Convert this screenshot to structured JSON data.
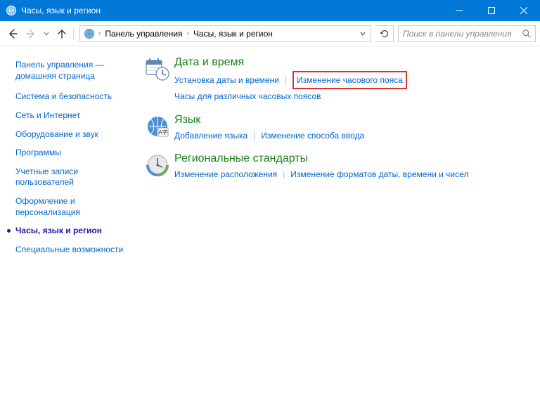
{
  "window": {
    "title": "Часы, язык и регион"
  },
  "breadcrumb": {
    "root": "Панель управления",
    "current": "Часы, язык и регион"
  },
  "search": {
    "placeholder": "Поиск в панели управления"
  },
  "sidebar": {
    "home": "Панель управления — домашняя страница",
    "items": [
      {
        "label": "Система и безопасность"
      },
      {
        "label": "Сеть и Интернет"
      },
      {
        "label": "Оборудование и звук"
      },
      {
        "label": "Программы"
      },
      {
        "label": "Учетные записи пользователей"
      },
      {
        "label": "Оформление и персонализация"
      },
      {
        "label": "Часы, язык и регион",
        "active": true
      },
      {
        "label": "Специальные возможности"
      }
    ]
  },
  "main": {
    "categories": [
      {
        "title": "Дата и время",
        "links_row1": [
          "Установка даты и времени",
          "Изменение часового пояса"
        ],
        "links_row2": [
          "Часы для различных часовых поясов"
        ],
        "highlight_index": 1
      },
      {
        "title": "Язык",
        "links_row1": [
          "Добавление языка",
          "Изменение способа ввода"
        ]
      },
      {
        "title": "Региональные стандарты",
        "links_row1": [
          "Изменение расположения",
          "Изменение форматов даты, времени и чисел"
        ]
      }
    ]
  }
}
